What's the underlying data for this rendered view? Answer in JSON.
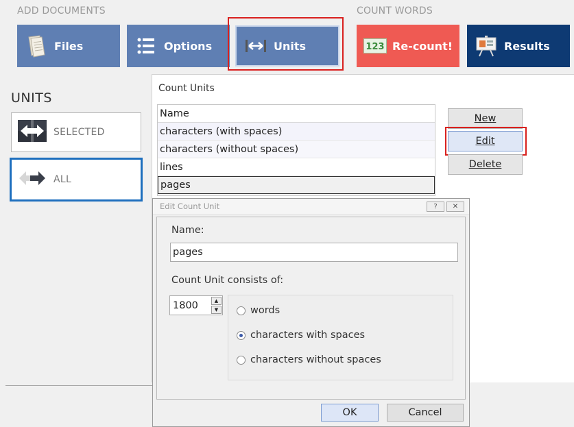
{
  "ribbon": {
    "add_documents_label": "ADD DOCUMENTS",
    "count_words_label": "COUNT WORDS",
    "buttons": [
      {
        "label": "Files",
        "icon": "document-icon"
      },
      {
        "label": "Options",
        "icon": "list-icon"
      },
      {
        "label": "Units",
        "icon": "arrows-horizontal-icon"
      },
      {
        "label": "Re-count!",
        "icon": "counter-123-icon"
      },
      {
        "label": "Results",
        "icon": "presentation-icon"
      }
    ]
  },
  "sidebar": {
    "title": "UNITS",
    "items": [
      {
        "label": "SELECTED",
        "icon": "arrows-selected-icon"
      },
      {
        "label": "ALL",
        "icon": "arrows-all-icon"
      }
    ]
  },
  "count_units": {
    "title": "Count Units",
    "column_header": "Name",
    "rows": [
      "characters (with spaces)",
      "characters (without spaces)",
      "lines",
      "pages"
    ],
    "selected_row": "pages",
    "buttons": {
      "new": "New",
      "edit": "Edit",
      "delete": "Delete"
    }
  },
  "dialog": {
    "title": "Edit Count Unit",
    "help_btn": "?",
    "close_btn": "✕",
    "name_label": "Name:",
    "name_value": "pages",
    "consists_label": "Count Unit consists of:",
    "count_value": "1800",
    "options": [
      "words",
      "characters with spaces",
      "characters without spaces"
    ],
    "selected_option": "characters with spaces",
    "ok": "OK",
    "cancel": "Cancel"
  },
  "colors": {
    "ribbon_blue": "#5f7fb3",
    "recount_red": "#ef5a53",
    "results_navy": "#0e3a73",
    "highlight_red": "#d9201e",
    "active_border": "#1e6fbe"
  }
}
